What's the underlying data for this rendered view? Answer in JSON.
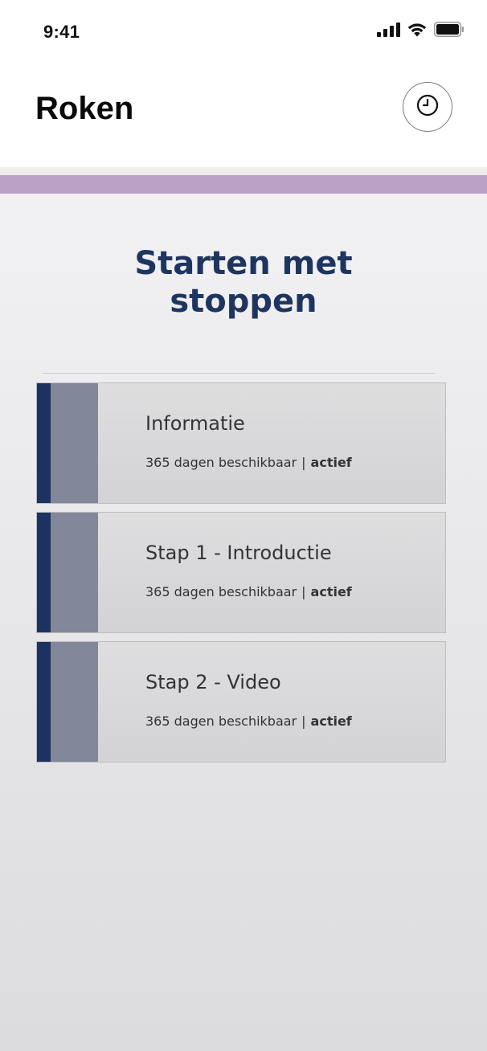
{
  "status_bar": {
    "time": "9:41"
  },
  "header": {
    "title": "Roken",
    "history_button_icon": "clock-icon"
  },
  "colors": {
    "accent_bar": "#bca1c6",
    "title_navy": "#1e3560",
    "card_stripe": "#1c3260"
  },
  "section": {
    "title_line1": "Starten met",
    "title_line2": "stoppen"
  },
  "modules": [
    {
      "title": "Informatie",
      "availability": "365 dagen beschikbaar",
      "separator": "|",
      "status": "actief"
    },
    {
      "title": "Stap 1 - Introductie",
      "availability": "365 dagen beschikbaar",
      "separator": "|",
      "status": "actief"
    },
    {
      "title": "Stap 2 - Video",
      "availability": "365 dagen beschikbaar",
      "separator": "|",
      "status": "actief"
    }
  ]
}
